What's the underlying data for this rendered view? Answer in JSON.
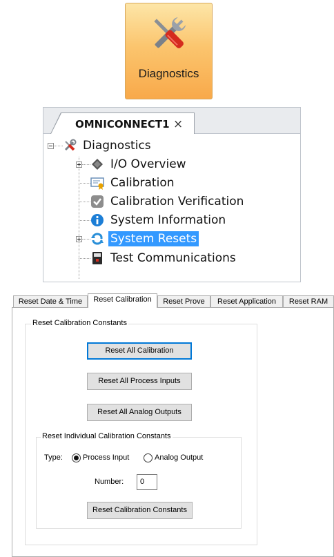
{
  "ribbon": {
    "label": "Diagnostics"
  },
  "tree": {
    "tab_title": "OMNICONNECT1",
    "close_glyph": "×",
    "root": "Diagnostics",
    "items": [
      {
        "label": "I/O Overview",
        "icon": "io-overview-icon",
        "expandable": true
      },
      {
        "label": "Calibration",
        "icon": "calibration-icon",
        "expandable": false
      },
      {
        "label": "Calibration Verification",
        "icon": "check-badge-icon",
        "expandable": false
      },
      {
        "label": "System Information",
        "icon": "info-icon",
        "expandable": false
      },
      {
        "label": "System Resets",
        "icon": "reset-icon",
        "expandable": true,
        "selected": true
      },
      {
        "label": "Test Communications",
        "icon": "communications-device-icon",
        "expandable": false
      }
    ]
  },
  "dialog": {
    "tabs": [
      "Reset Date & Time",
      "Reset Calibration",
      "Reset Prove",
      "Reset Application",
      "Reset RAM"
    ],
    "active_tab": "Reset Calibration",
    "group_title": "Reset Calibration Constants",
    "buttons": {
      "reset_all_calibration": "Reset All Calibration",
      "reset_all_process_inputs": "Reset All Process Inputs",
      "reset_all_analog_outputs": "Reset All Analog Outputs"
    },
    "individual": {
      "title": "Reset Individual Calibration Constants",
      "type_label": "Type:",
      "options": [
        "Process Input",
        "Analog Output"
      ],
      "selected_option": "Process Input",
      "number_label": "Number:",
      "number_value": "0",
      "reset_button": "Reset Calibration Constants"
    }
  },
  "colors": {
    "selection": "#3399ff",
    "ribbon_orange": "#f8a94a",
    "default_button_border": "#0078d7"
  }
}
